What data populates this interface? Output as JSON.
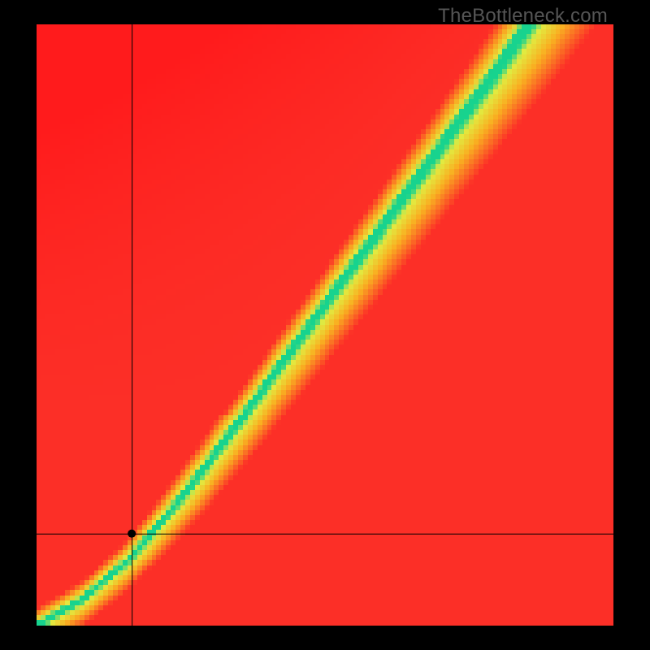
{
  "watermark": "TheBottleneck.com",
  "chart_data": {
    "type": "heatmap",
    "title": "",
    "xlabel": "",
    "ylabel": "",
    "xlim": [
      0,
      100
    ],
    "ylim": [
      0,
      100
    ],
    "grid": false,
    "legend": false,
    "width_cells": 120,
    "height_cells": 120,
    "marker": {
      "x": 16.5,
      "y": 15.3
    },
    "crosshair": {
      "x": 16.5,
      "y": 15.3
    },
    "ideal_curve_anchors": [
      {
        "x": 0.0,
        "y": 0.0
      },
      {
        "x": 0.08,
        "y": 0.045
      },
      {
        "x": 0.16,
        "y": 0.11
      },
      {
        "x": 0.24,
        "y": 0.2
      },
      {
        "x": 0.32,
        "y": 0.3
      },
      {
        "x": 0.4,
        "y": 0.405
      },
      {
        "x": 0.48,
        "y": 0.51
      },
      {
        "x": 0.56,
        "y": 0.615
      },
      {
        "x": 0.64,
        "y": 0.72
      },
      {
        "x": 0.72,
        "y": 0.825
      },
      {
        "x": 0.8,
        "y": 0.93
      },
      {
        "x": 0.85,
        "y": 1.0
      }
    ],
    "colors": {
      "good": "#17d38e",
      "edge": "#e2ea40",
      "mid": "#f9b021",
      "bad": "#fc2f27",
      "bad_top": "#ff1b1c"
    },
    "value_meaning": "distance to ideal-balance curve (0 = green/optimal, 1 = red/bottlenecked)",
    "axes_meaning": "x: component A capability (normalized 0-1), y: component B capability (normalized 0-1)"
  }
}
